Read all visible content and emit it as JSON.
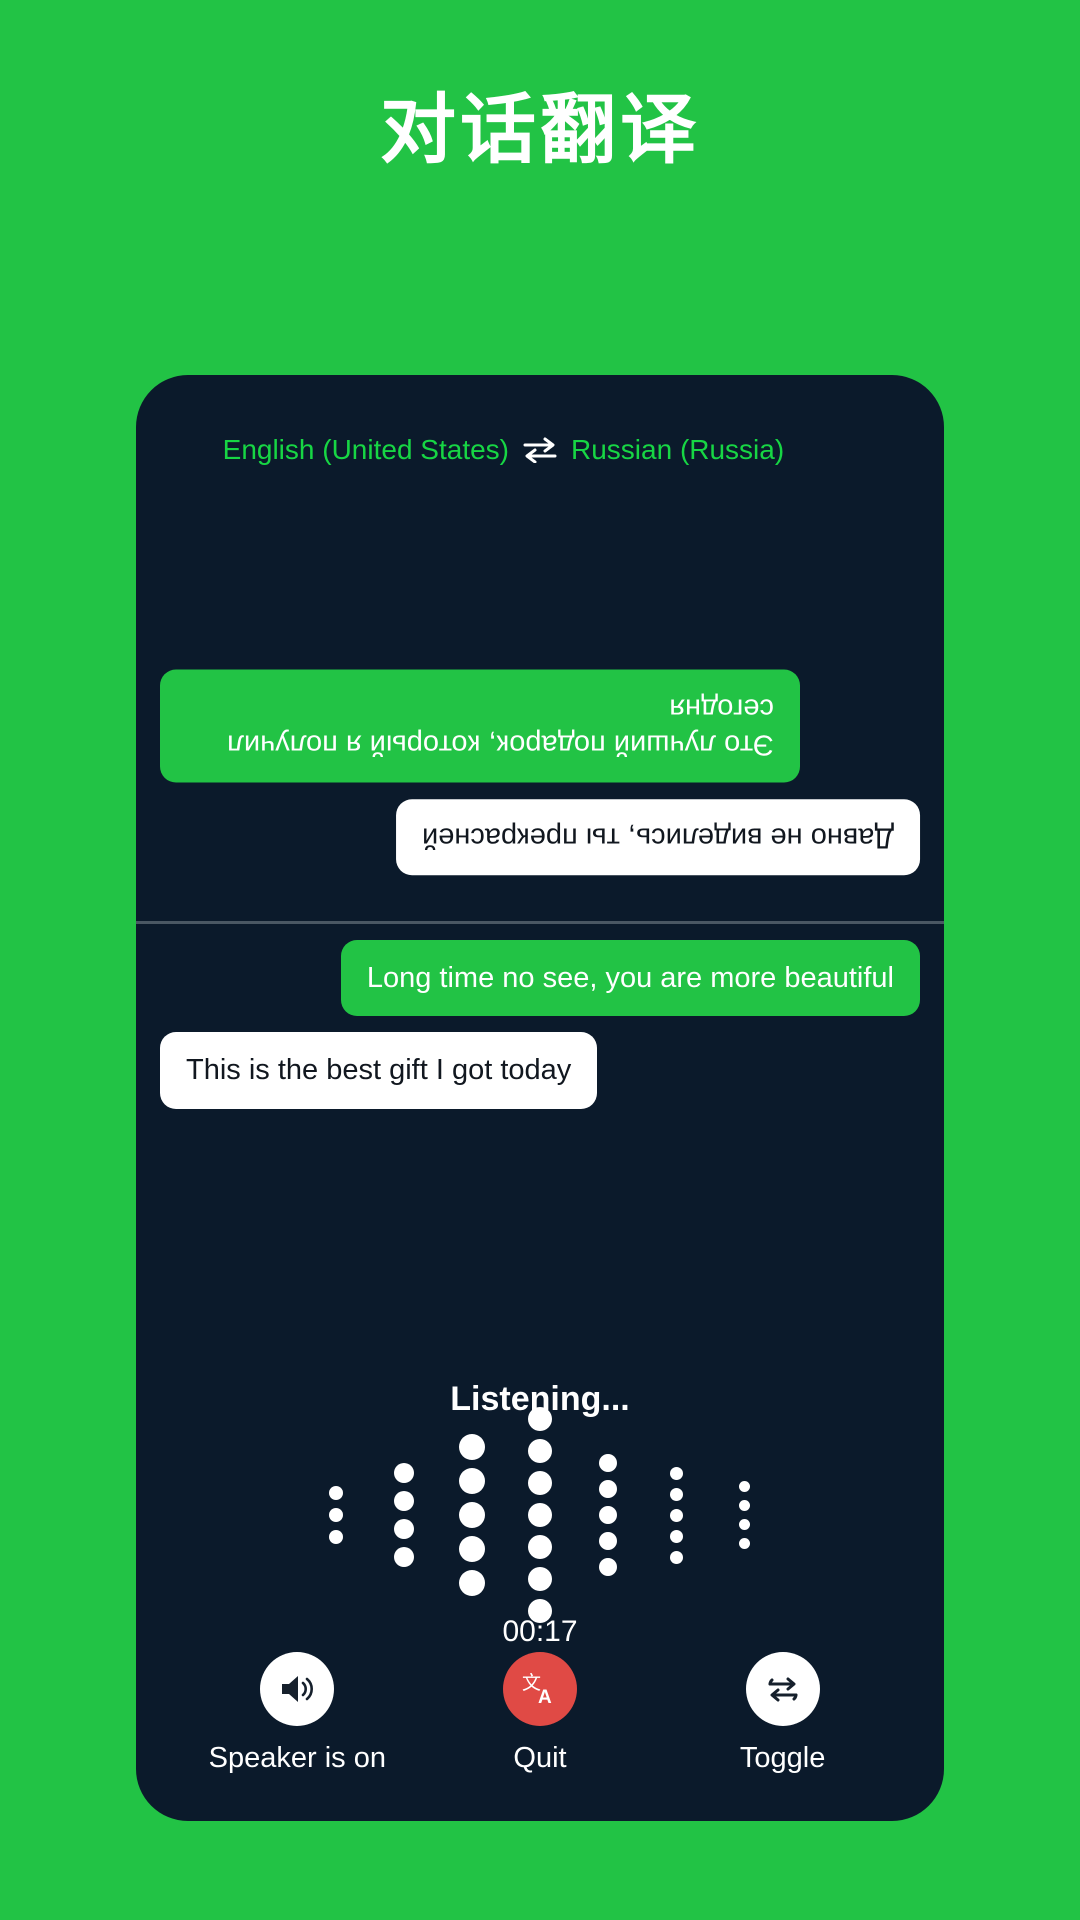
{
  "page": {
    "title": "对话翻译",
    "background_color": "#22c345"
  },
  "phone": {
    "background_color": "#0b1a2b",
    "language_bar": {
      "source_language": "English (United States)",
      "swap_icon": "swap-horizontal-icon",
      "target_language": "Russian (Russia)",
      "language_color": "#17d644"
    },
    "conversation_top": {
      "rotated": true,
      "messages": [
        {
          "text": "Это лучший подарок, который я получил сегодня",
          "style": "green",
          "align": "left"
        },
        {
          "text": "Давно не виделись, ты прекрасней",
          "style": "white",
          "align": "right"
        }
      ]
    },
    "conversation_bottom": {
      "rotated": false,
      "messages": [
        {
          "text": "Long time no see, you are more beautiful",
          "style": "green",
          "align": "right"
        },
        {
          "text": "This is the best gift I got today",
          "style": "white",
          "align": "left"
        }
      ]
    },
    "listening": {
      "status_label": "Listening...",
      "timer": "00:17",
      "waveform": {
        "type": "dot-bars",
        "columns": [
          {
            "dots": 3,
            "size": 14
          },
          {
            "dots": 4,
            "size": 20
          },
          {
            "dots": 5,
            "size": 26
          },
          {
            "dots": 7,
            "size": 24
          },
          {
            "dots": 5,
            "size": 18
          },
          {
            "dots": 5,
            "size": 13
          },
          {
            "dots": 4,
            "size": 11
          }
        ],
        "dot_color": "#ffffff"
      }
    },
    "controls": [
      {
        "label": "Speaker is on",
        "icon": "speaker-on-icon",
        "style": "light",
        "circle_color": "#ffffff"
      },
      {
        "label": "Quit",
        "icon": "translate-icon",
        "style": "danger",
        "circle_color": "#e04a45"
      },
      {
        "label": "Toggle",
        "icon": "swap-repeat-icon",
        "style": "light",
        "circle_color": "#ffffff"
      }
    ]
  }
}
